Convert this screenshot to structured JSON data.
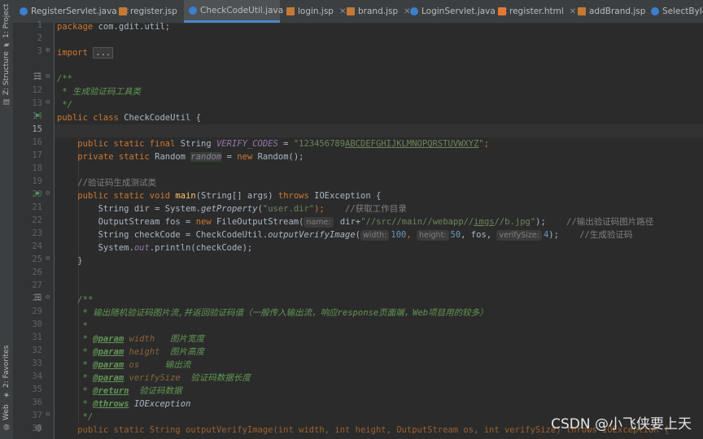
{
  "sidebar": {
    "project": "1: Project",
    "structure": "Z: Structure",
    "favorites": "2: Favorites",
    "web": "Web"
  },
  "tabs": [
    {
      "label": "RegisterServlet.java",
      "type": "java"
    },
    {
      "label": "register.jsp",
      "type": "jsp"
    },
    {
      "label": "CheckCodeUtil.java",
      "type": "java",
      "active": true
    },
    {
      "label": "login.jsp",
      "type": "jsp"
    },
    {
      "label": "brand.jsp",
      "type": "jsp"
    },
    {
      "label": "LoginServlet.java",
      "type": "java"
    },
    {
      "label": "register.html",
      "type": "html"
    },
    {
      "label": "addBrand.jsp",
      "type": "jsp"
    },
    {
      "label": "SelectByIdSe",
      "type": "java"
    }
  ],
  "line_numbers": [
    "1",
    "2",
    "3",
    "11",
    "12",
    "13",
    "14",
    "15",
    "16",
    "17",
    "18",
    "19",
    "20",
    "21",
    "22",
    "23",
    "24",
    "25",
    "26",
    "27",
    "28",
    "29",
    "30",
    "31",
    "32",
    "33",
    "34",
    "35",
    "36",
    "37",
    "38"
  ],
  "code": {
    "l1": {
      "kw": "package",
      "rest": " com.gdit.util;"
    },
    "l3": {
      "kw": "import",
      "folded": "..."
    },
    "l11": "/**",
    "l12": " * 生成验证码工具类",
    "l13": " */",
    "l14": {
      "kw1": "public",
      "kw2": "class",
      "name": " CheckCodeUtil {"
    },
    "l16": {
      "kw": "public static final",
      "type": " String ",
      "field": "VERIFY_CODES",
      "eq": " = ",
      "str1": "\"123456789",
      "str2": "ABCDEFGHIJKLMNOPQRSTUVWXYZ",
      "str3": "\"",
      "end": ";"
    },
    "l17": {
      "kw": "private static",
      "type": " Random ",
      "field": "random",
      "eq": " = ",
      "kw2": "new",
      "end": " Random();"
    },
    "l19": "//验证码生成测试类",
    "l20": {
      "kw": "public static void",
      "name": "main",
      "params": "(String[] args) ",
      "kw2": "throws",
      "end": " IOException {"
    },
    "l21": {
      "a": "String dir = System.",
      "m": "getProperty",
      "b": "(",
      "s": "\"user.dir\"",
      "c": ");",
      "cm": "//获取工作目录"
    },
    "l22": {
      "a": "OutputStream fos = ",
      "kw": "new",
      "b": " FileOutputStream(",
      "hint": "name:",
      "c": " dir+",
      "s": "\"//src//main//webapp//",
      "s2": "imgs",
      "s3": "//b.jpg\"",
      "d": ");",
      "cm": "//输出验证码图片路径"
    },
    "l23": {
      "a": "String checkCode = CheckCodeUtil.",
      "m": "outputVerifyImage",
      "b": "(",
      "h1": "width:",
      "n1": "100",
      "h2": "height:",
      "n2": "50",
      "c": ", fos, ",
      "h3": "verifySize:",
      "n3": "4",
      "d": ");",
      "cm": "//生成验证码"
    },
    "l24": {
      "a": "System.",
      "f": "out",
      "b": ".println(checkCode);"
    },
    "l25": "}",
    "l28": "/**",
    "l29": " * 输出随机验证码图片流,并返回验证码值（一般传入输出流，响应response页面端，Web项目用的较多）",
    "l30": " *",
    "l31": {
      "tag": "@param",
      "p": "width",
      "d": "图片宽度"
    },
    "l32": {
      "tag": "@param",
      "p": "height",
      "d": "图片高度"
    },
    "l33": {
      "tag": "@param",
      "p": "os",
      "d": "输出流"
    },
    "l34": {
      "tag": "@param",
      "p": "verifySize",
      "d": "验证码数据长度"
    },
    "l35": {
      "tag": "@return",
      "d": "验证码数据"
    },
    "l36": {
      "tag": "@throws",
      "d": "IOException"
    },
    "l37": " */",
    "l38": "public static String outputVerifyImage(int width, int height, OutputStream os, int verifySize) throws IOException {"
  },
  "watermark": "CSDN @小飞侠要上天"
}
